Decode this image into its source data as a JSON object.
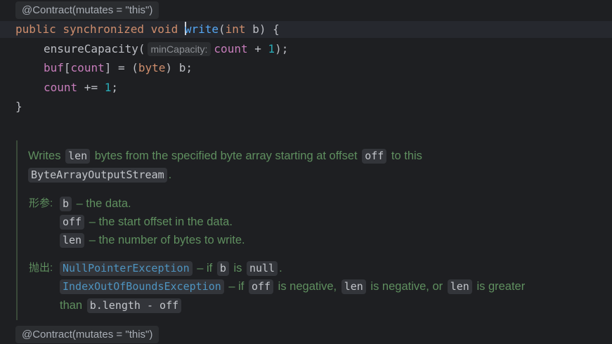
{
  "annotation_top": "@Contract(mutates = \"this\")",
  "annotation_bottom": "@Contract(mutates = \"this\")",
  "code": {
    "kw_public": "public",
    "kw_sync": "synchronized",
    "kw_void": "void",
    "method_w": "w",
    "method_rest": "rite",
    "paren_open": "(",
    "kw_int": "int",
    "param_sig": " b) {",
    "line2_call": "ensureCapacity(",
    "line2_hint": "minCapacity:",
    "line2_field": "count",
    "line2_plus": " + ",
    "line2_num": "1",
    "line2_end": ");",
    "line3_field": "buf",
    "line3_bracket_open": "[",
    "line3_field2": "count",
    "line3_mid": "] = (",
    "line3_kw": "byte",
    "line3_end": ") b;",
    "line4_field": "count",
    "line4_op": " += ",
    "line4_num": "1",
    "line4_end": ";",
    "line5": "}"
  },
  "doc": {
    "desc_1": "Writes",
    "desc_len": "len",
    "desc_2": "bytes from the specified byte array starting at offset",
    "desc_off": "off",
    "desc_3": "to this",
    "desc_stream": "ByteArrayOutputStream",
    "desc_end": ".",
    "params_label": "形参:",
    "p1_code": "b",
    "p1_text": "– the data.",
    "p2_code": "off",
    "p2_text": "– the start offset in the data.",
    "p3_code": "len",
    "p3_text": "– the number of bytes to write.",
    "throws_label": "抛出:",
    "t1_exc": "NullPointerException",
    "t1_if": "– if",
    "t1_b": "b",
    "t1_is": "is",
    "t1_null": "null",
    "t1_end": ".",
    "t2_exc": "IndexOutOfBoundsException",
    "t2_if": "– if",
    "t2_off": "off",
    "t2_neg1": "is negative,",
    "t2_len": "len",
    "t2_neg2": "is negative, or",
    "t2_len2": "len",
    "t2_greater": "is greater",
    "t2_than": "than",
    "t2_expr": "b.length - off"
  }
}
